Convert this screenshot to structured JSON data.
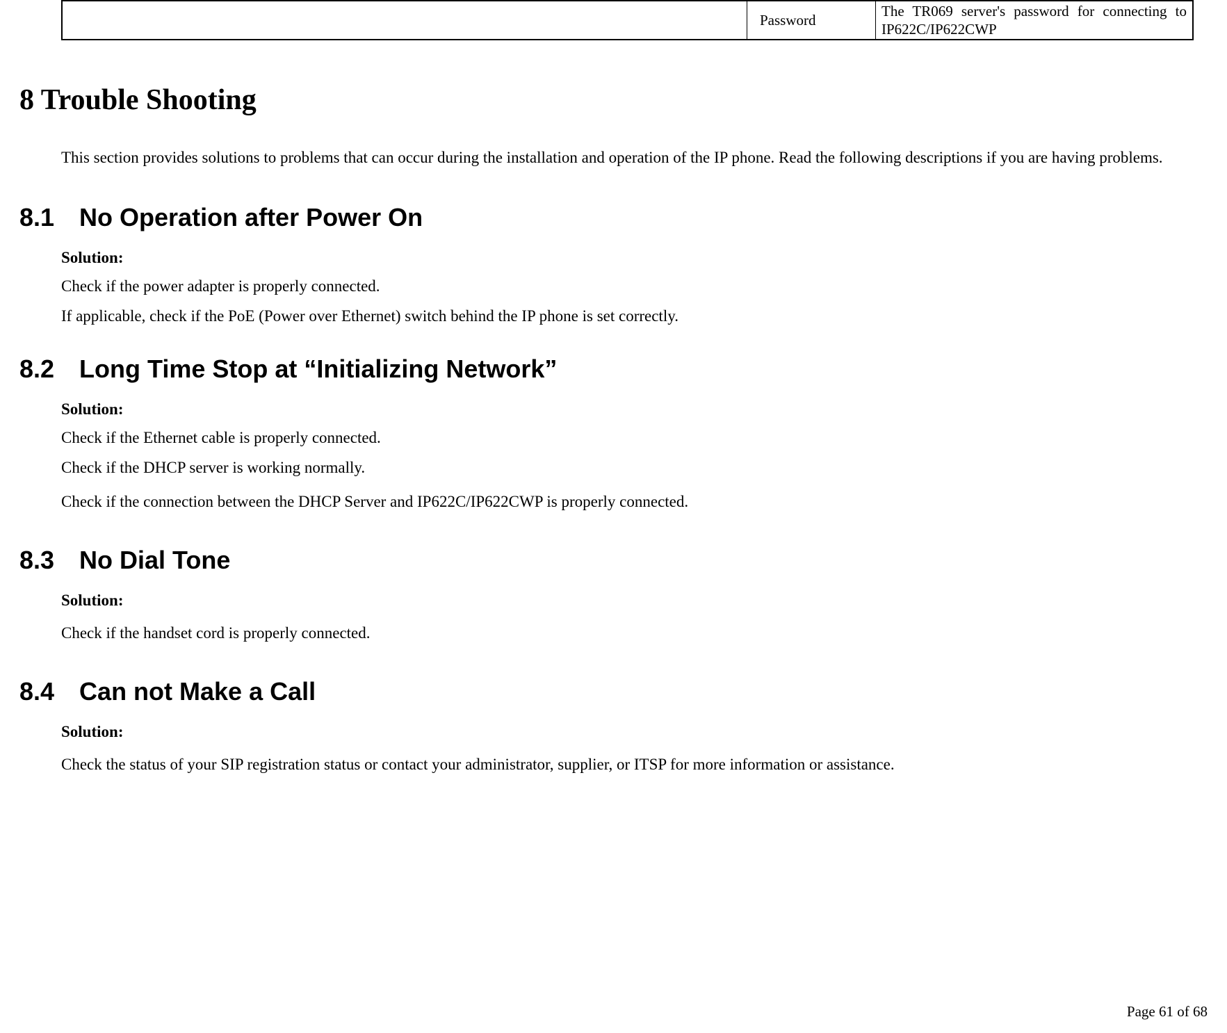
{
  "table": {
    "label": "Password",
    "description": "The TR069 server's password for connecting to IP622C/IP622CWP"
  },
  "h1": "8 Trouble Shooting",
  "intro": "This section provides solutions to problems that can occur during the installation and operation of the IP phone. Read the following descriptions if you are having problems.",
  "sections": {
    "s81": {
      "heading": "8.1 No Operation after Power On",
      "solution_label": "Solution:",
      "body1": "Check if the power adapter is properly connected.",
      "body2": "If applicable, check if the PoE (Power over Ethernet) switch behind the IP phone is set correctly."
    },
    "s82": {
      "heading": "8.2 Long Time Stop at “Initializing Network”",
      "solution_label": "Solution:",
      "body1": "Check if the Ethernet cable is properly connected.",
      "body2": "Check if the DHCP server is working normally.",
      "body3": "Check if the connection between the DHCP Server and IP622C/IP622CWP is properly connected."
    },
    "s83": {
      "heading": "8.3 No Dial Tone",
      "solution_label": "Solution:",
      "body1": "Check if the handset cord is properly connected."
    },
    "s84": {
      "heading": "8.4 Can not Make a Call",
      "solution_label": "Solution:",
      "body1": "Check the status of your SIP registration status or contact your administrator, supplier, or ITSP for more information or assistance."
    }
  },
  "footer": "Page 61 of 68"
}
